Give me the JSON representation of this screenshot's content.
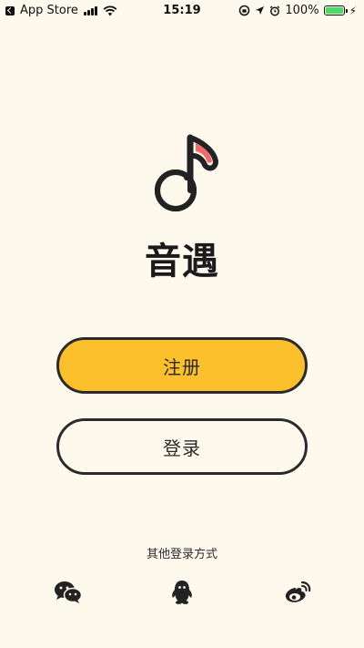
{
  "status_bar": {
    "back_app": "App Store",
    "time": "15:19",
    "battery": "100%",
    "battery_level": 1.0,
    "battery_color": "#4cd964"
  },
  "app": {
    "name": "音遇",
    "logo_icon": "music-note-icon",
    "logo_accent": "#f06a6a"
  },
  "buttons": {
    "register": "注册",
    "login": "登录",
    "register_color": "#fcc02d"
  },
  "social": {
    "label": "其他登录方式",
    "items": [
      {
        "name": "wechat",
        "icon": "wechat-icon"
      },
      {
        "name": "qq",
        "icon": "qq-icon"
      },
      {
        "name": "weibo",
        "icon": "weibo-icon"
      }
    ]
  }
}
